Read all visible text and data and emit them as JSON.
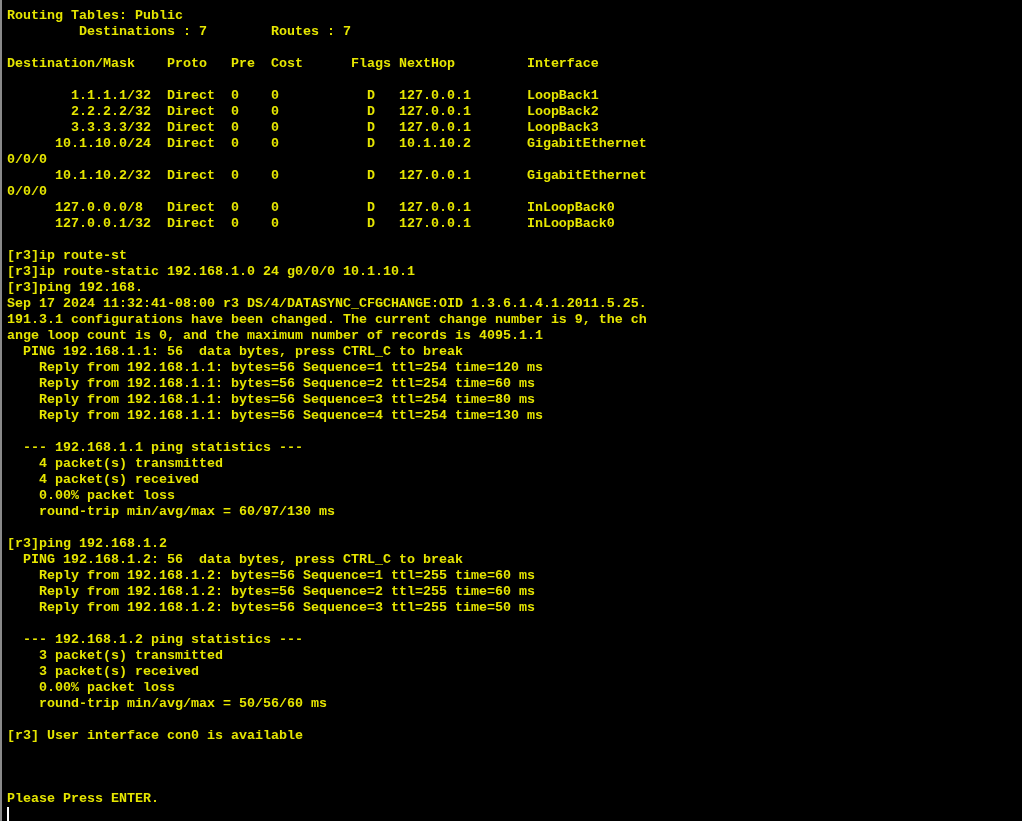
{
  "terminal": {
    "blocks": [
      [
        "Routing Tables: Public",
        "         Destinations : 7        Routes : 7"
      ],
      [
        "Destination/Mask    Proto   Pre  Cost      Flags NextHop         Interface"
      ],
      [
        "        1.1.1.1/32  Direct  0    0           D   127.0.0.1       LoopBack1",
        "        2.2.2.2/32  Direct  0    0           D   127.0.0.1       LoopBack2",
        "        3.3.3.3/32  Direct  0    0           D   127.0.0.1       LoopBack3",
        "      10.1.10.0/24  Direct  0    0           D   10.1.10.2       GigabitEthernet",
        "0/0/0",
        "      10.1.10.2/32  Direct  0    0           D   127.0.0.1       GigabitEthernet",
        "0/0/0",
        "      127.0.0.0/8   Direct  0    0           D   127.0.0.1       InLoopBack0",
        "      127.0.0.1/32  Direct  0    0           D   127.0.0.1       InLoopBack0"
      ],
      [
        "[r3]ip route-st",
        "[r3]ip route-static 192.168.1.0 24 g0/0/0 10.1.10.1",
        "[r3]ping 192.168.",
        "Sep 17 2024 11:32:41-08:00 r3 DS/4/DATASYNC_CFGCHANGE:OID 1.3.6.1.4.1.2011.5.25.",
        "191.3.1 configurations have been changed. The current change number is 9, the ch",
        "ange loop count is 0, and the maximum number of records is 4095.1.1",
        "  PING 192.168.1.1: 56  data bytes, press CTRL_C to break",
        "    Reply from 192.168.1.1: bytes=56 Sequence=1 ttl=254 time=120 ms",
        "    Reply from 192.168.1.1: bytes=56 Sequence=2 ttl=254 time=60 ms",
        "    Reply from 192.168.1.1: bytes=56 Sequence=3 ttl=254 time=80 ms",
        "    Reply from 192.168.1.1: bytes=56 Sequence=4 ttl=254 time=130 ms"
      ],
      [
        "  --- 192.168.1.1 ping statistics ---",
        "    4 packet(s) transmitted",
        "    4 packet(s) received",
        "    0.00% packet loss",
        "    round-trip min/avg/max = 60/97/130 ms"
      ],
      [
        "[r3]ping 192.168.1.2",
        "  PING 192.168.1.2: 56  data bytes, press CTRL_C to break",
        "    Reply from 192.168.1.2: bytes=56 Sequence=1 ttl=255 time=60 ms",
        "    Reply from 192.168.1.2: bytes=56 Sequence=2 ttl=255 time=60 ms",
        "    Reply from 192.168.1.2: bytes=56 Sequence=3 ttl=255 time=50 ms"
      ],
      [
        "  --- 192.168.1.2 ping statistics ---",
        "    3 packet(s) transmitted",
        "    3 packet(s) received",
        "    0.00% packet loss",
        "    round-trip min/avg/max = 50/56/60 ms"
      ],
      [
        "[r3] User interface con0 is available"
      ]
    ],
    "prompt": "Please Press ENTER."
  }
}
